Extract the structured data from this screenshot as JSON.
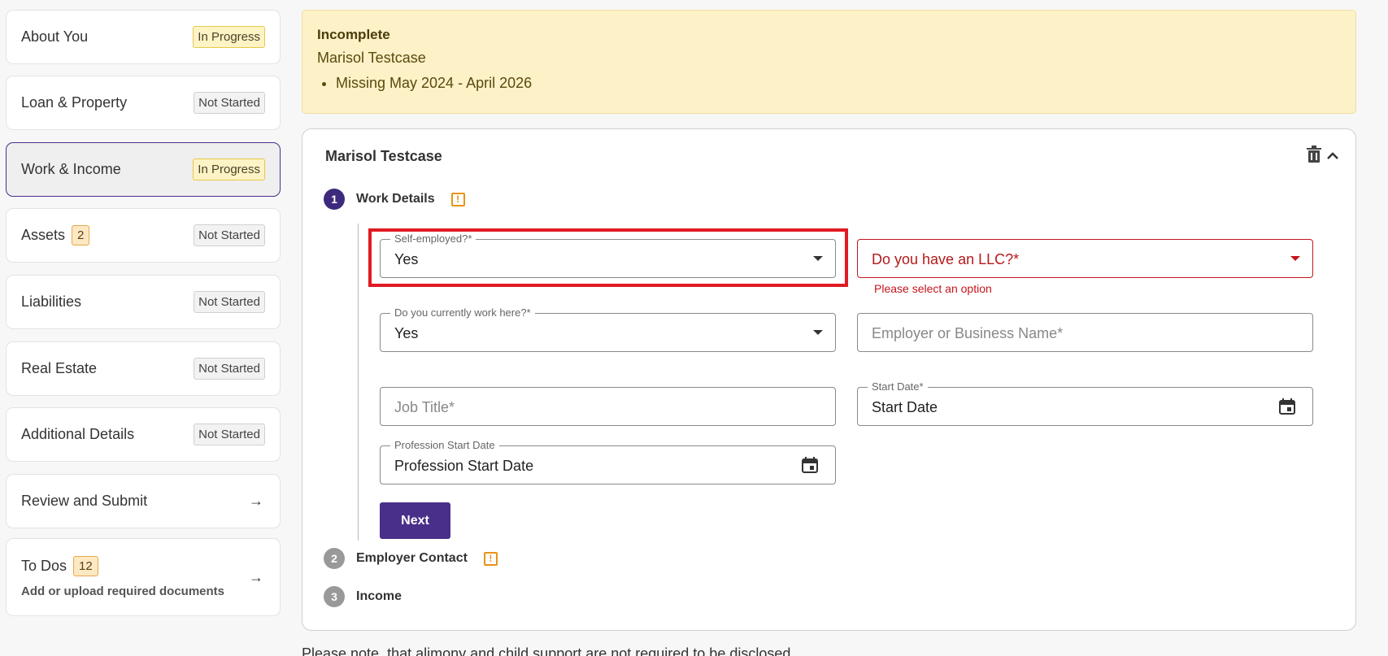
{
  "sidebar": {
    "items": [
      {
        "label": "About You",
        "status": "In Progress"
      },
      {
        "label": "Loan & Property",
        "status": "Not Started"
      },
      {
        "label": "Work & Income",
        "status": "In Progress"
      },
      {
        "label": "Assets",
        "count": "2",
        "status": "Not Started"
      },
      {
        "label": "Liabilities",
        "status": "Not Started"
      },
      {
        "label": "Real Estate",
        "status": "Not Started"
      },
      {
        "label": "Additional Details",
        "status": "Not Started"
      },
      {
        "label": "Review and Submit"
      },
      {
        "label": "To Dos",
        "count": "12",
        "sub": "Add or upload required documents"
      }
    ]
  },
  "alert": {
    "title": "Incomplete",
    "name": "Marisol Testcase",
    "items": [
      "Missing May 2024 - April 2026"
    ]
  },
  "card": {
    "title": "Marisol Testcase",
    "steps": [
      {
        "num": "1",
        "label": "Work Details"
      },
      {
        "num": "2",
        "label": "Employer Contact"
      },
      {
        "num": "3",
        "label": "Income"
      }
    ],
    "fields": {
      "self_employed": {
        "label": "Self-employed?*",
        "value": "Yes"
      },
      "llc": {
        "placeholder": "Do you have an LLC?*",
        "error": "Please select an option"
      },
      "currently_work": {
        "label": "Do you currently work here?*",
        "value": "Yes"
      },
      "employer": {
        "placeholder": "Employer or Business Name*"
      },
      "job_title": {
        "placeholder": "Job Title*"
      },
      "start_date": {
        "label": "Start Date*",
        "value": "Start Date"
      },
      "profession_start": {
        "label": "Profession Start Date",
        "value": "Profession Start Date"
      }
    },
    "next_label": "Next"
  },
  "footer_note": "Please note, that alimony and child support are not required to be disclosed.",
  "colors": {
    "primary": "#4a2f8a",
    "error": "#c3151c",
    "warning": "#e8931a",
    "alert_bg": "#fdf1c8"
  }
}
